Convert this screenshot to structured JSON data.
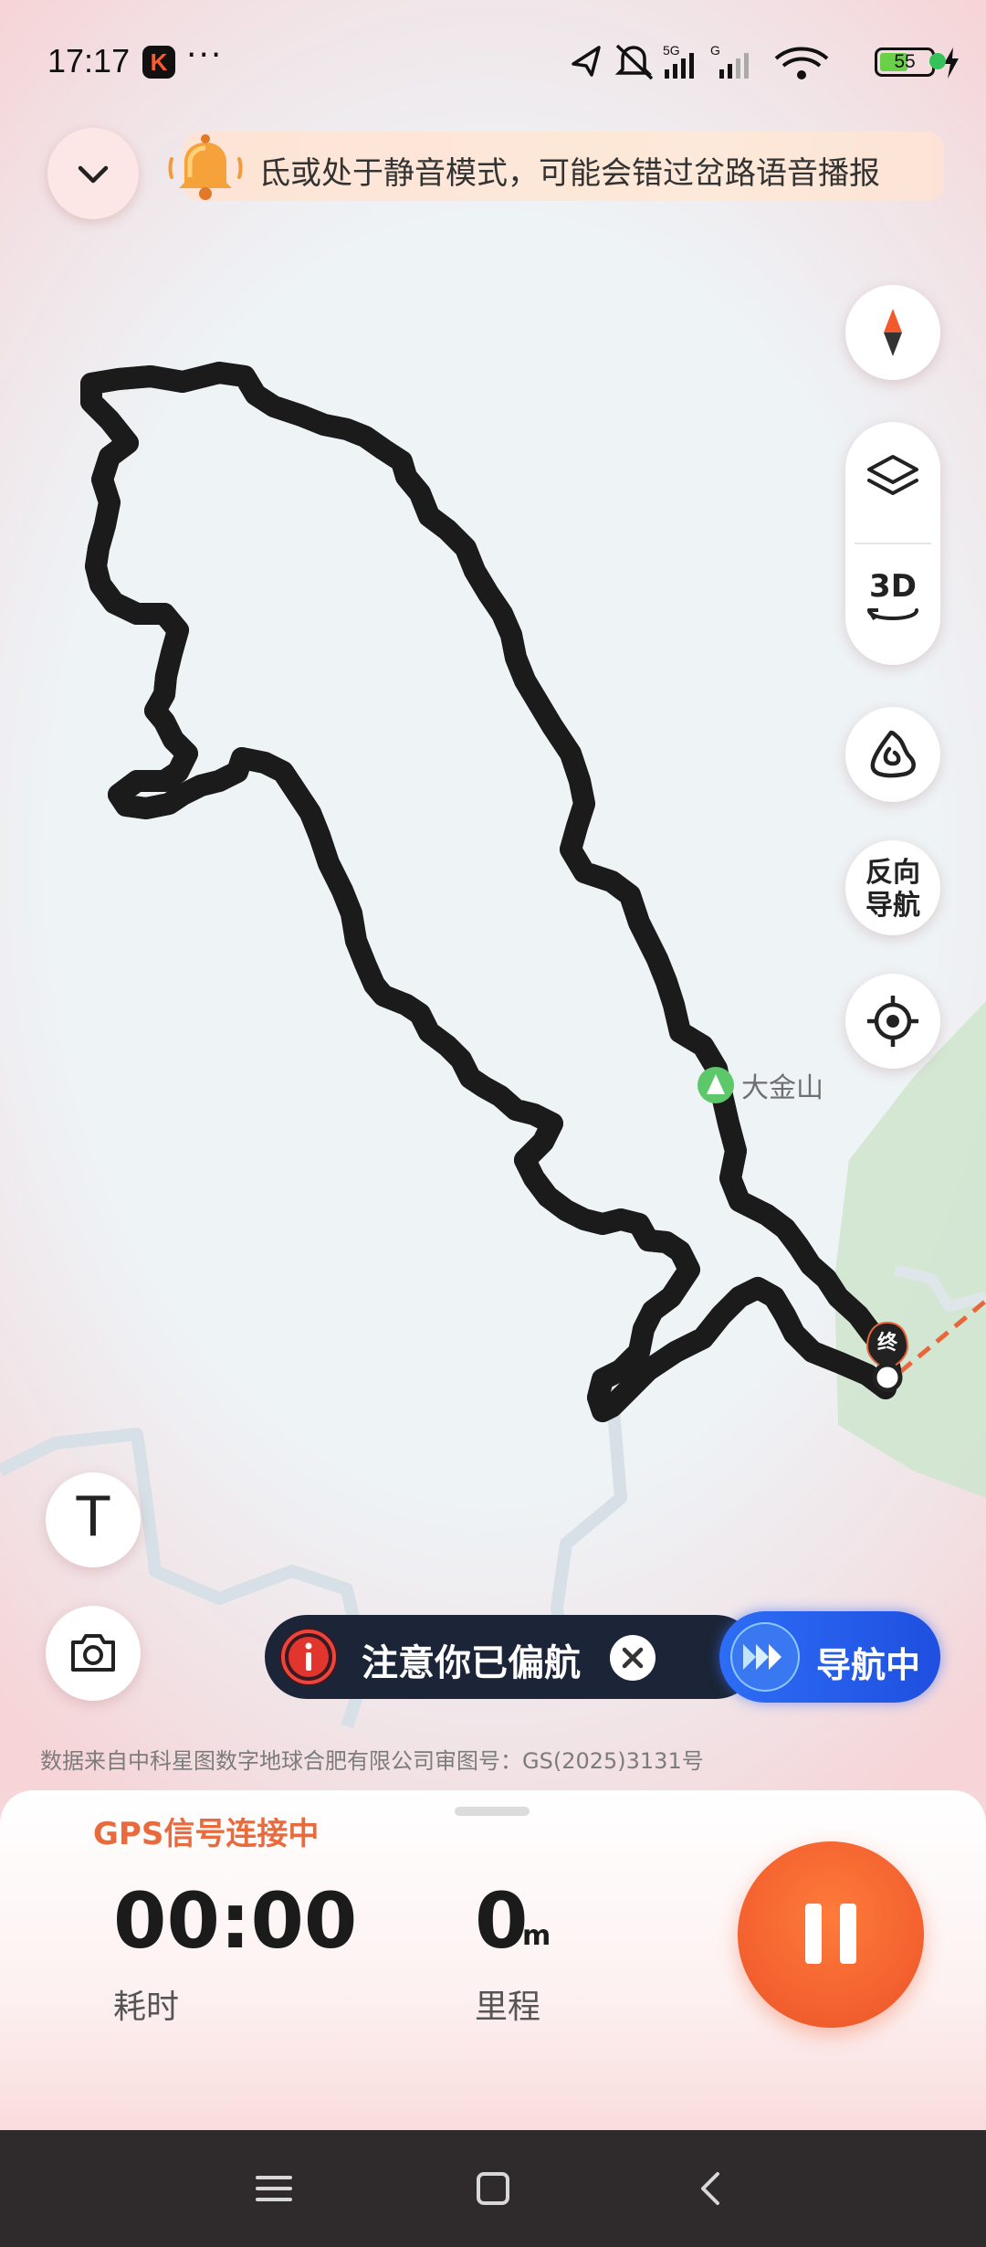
{
  "status_bar": {
    "time": "17:17",
    "app_badge": "K",
    "more": "···",
    "battery": "55",
    "battery_level": 0.55,
    "network_label": "5G"
  },
  "notice": {
    "text": "氐或处于静音模式，可能会错过岔路语音播报"
  },
  "controls": {
    "reverse_nav_line1": "反向",
    "reverse_nav_line2": "导航",
    "layers_3d": "3D"
  },
  "map": {
    "poi_label": "大金山",
    "end_marker": "终",
    "attribution": "数据来自中科星图数字地球合肥有限公司审图号：GS(2025)3131号",
    "route_color": "#2ee0d2",
    "route_outline_color": "#1b1b1b"
  },
  "left_tools": {
    "text_tool": "T"
  },
  "banner": {
    "off_route_text": "注意你已偏航",
    "nav_status": "导航中"
  },
  "stats": {
    "gps_status": "GPS信号连接中",
    "time_value": "00:00",
    "time_label": "耗时",
    "distance_value": "0",
    "distance_unit": "m",
    "distance_label": "里程"
  },
  "colors": {
    "accent_orange": "#f25f2e",
    "nav_blue": "#2d6df5",
    "banner_dark": "#1b2537"
  }
}
